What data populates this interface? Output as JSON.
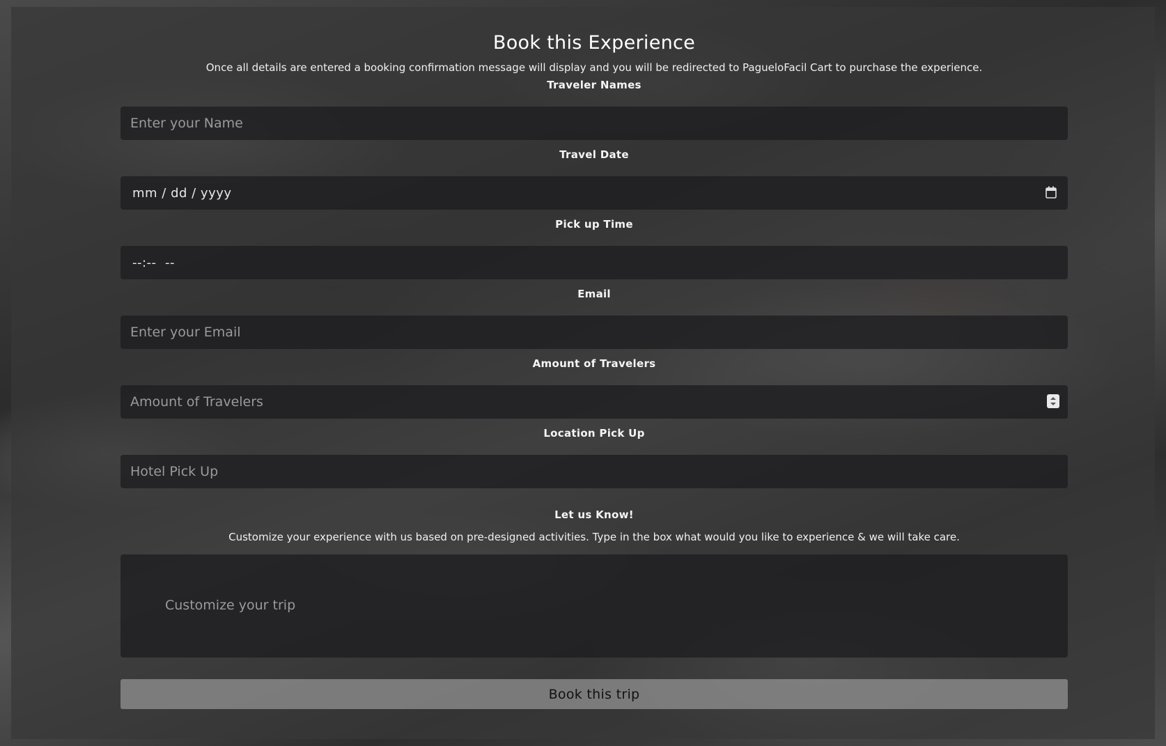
{
  "form": {
    "title": "Book this Experience",
    "intro": "Once all details are entered a booking confirmation message will display and you will be redirected to PagueloFacil Cart to purchase the experience.",
    "fields": {
      "traveler_names": {
        "label": "Traveler Names",
        "placeholder": "Enter your Name"
      },
      "travel_date": {
        "label": "Travel Date",
        "value": "mm / dd / yyyy",
        "icon": "calendar-icon"
      },
      "pickup_time": {
        "label": "Pick up Time",
        "value": "--:--  --"
      },
      "email": {
        "label": "Email",
        "placeholder": "Enter your Email"
      },
      "amount_travelers": {
        "label": "Amount of Travelers",
        "placeholder": "Amount of Travelers",
        "icon": "spinner-icon"
      },
      "location_pickup": {
        "label": "Location Pick Up",
        "placeholder": "Hotel Pick Up"
      },
      "customize": {
        "label": "Let us Know!",
        "description": "Customize your experience with us based on pre-designed activities. Type in the box what would you like to experience & we will take care.",
        "placeholder": "Customize your trip"
      }
    },
    "submit_label": "Book this trip"
  },
  "colors": {
    "panel": "#373737",
    "input_bg": "#1e1e20",
    "button_bg": "#969696",
    "placeholder": "#9a9a9a"
  }
}
